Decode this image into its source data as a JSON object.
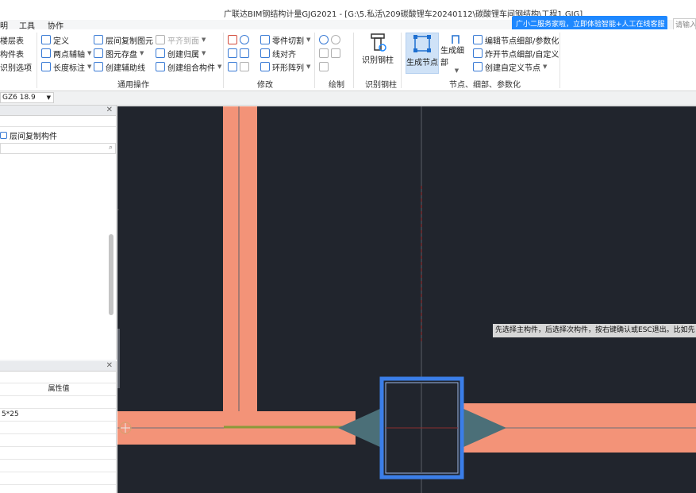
{
  "window": {
    "title": "广联达BIM钢结构计量GJG2021 - [G:\\5.私活\\209碳酸锂车20240112\\碳酸锂车间钢结构\\工程1.GJG]"
  },
  "menu": {
    "left_item": "明",
    "tools": "工具",
    "collab": "协作"
  },
  "ad": {
    "text": "广小二服务家啦，立即体验智能+人工在线客服",
    "search_placeholder": "请输入"
  },
  "ribbon": {
    "col0": [
      "楼层表",
      "构件表",
      "识别选项"
    ],
    "common": {
      "define": "定义",
      "copy_floor": "层间复制图元",
      "flat_view": "平齐到面",
      "two_point_axis": "两点辅轴",
      "save_elements": "图元存盘",
      "create_group_floor": "创建归属",
      "length_dim": "长度标注",
      "create_aux_line": "创建辅助线",
      "create_combo": "创建组合构件",
      "label": "通用操作"
    },
    "modify": {
      "part_cut": "零件切割",
      "line_align": "线对齐",
      "ring_array": "环形阵列",
      "label": "修改"
    },
    "draw": {
      "label": "绘制"
    },
    "recognize": {
      "col_btn": "识别钢柱",
      "label": "识别钢柱"
    },
    "nodes": {
      "gen_node": "生成节点",
      "gen_detail": "生成细部",
      "edit_node": "编辑节点细部/参数化",
      "split_node": "炸开节点细部/自定义",
      "create_custom": "创建自定义节点",
      "label": "节点、细部、参数化"
    }
  },
  "toolbar": {
    "combo_value": "GZ6 18.9"
  },
  "left_panel": {
    "copy_floor_btn": "层间复制构件",
    "prop_header": "属性值",
    "prop_value": "5*25"
  },
  "canvas": {
    "hint": "先选择主构件，后选择次构件，按右键确认或ESC退出。比如先"
  },
  "colors": {
    "beam": "#f39378",
    "canvas_bg": "#21252d",
    "node_plate": "#4b6f78",
    "selection": "#3b7ee8"
  }
}
